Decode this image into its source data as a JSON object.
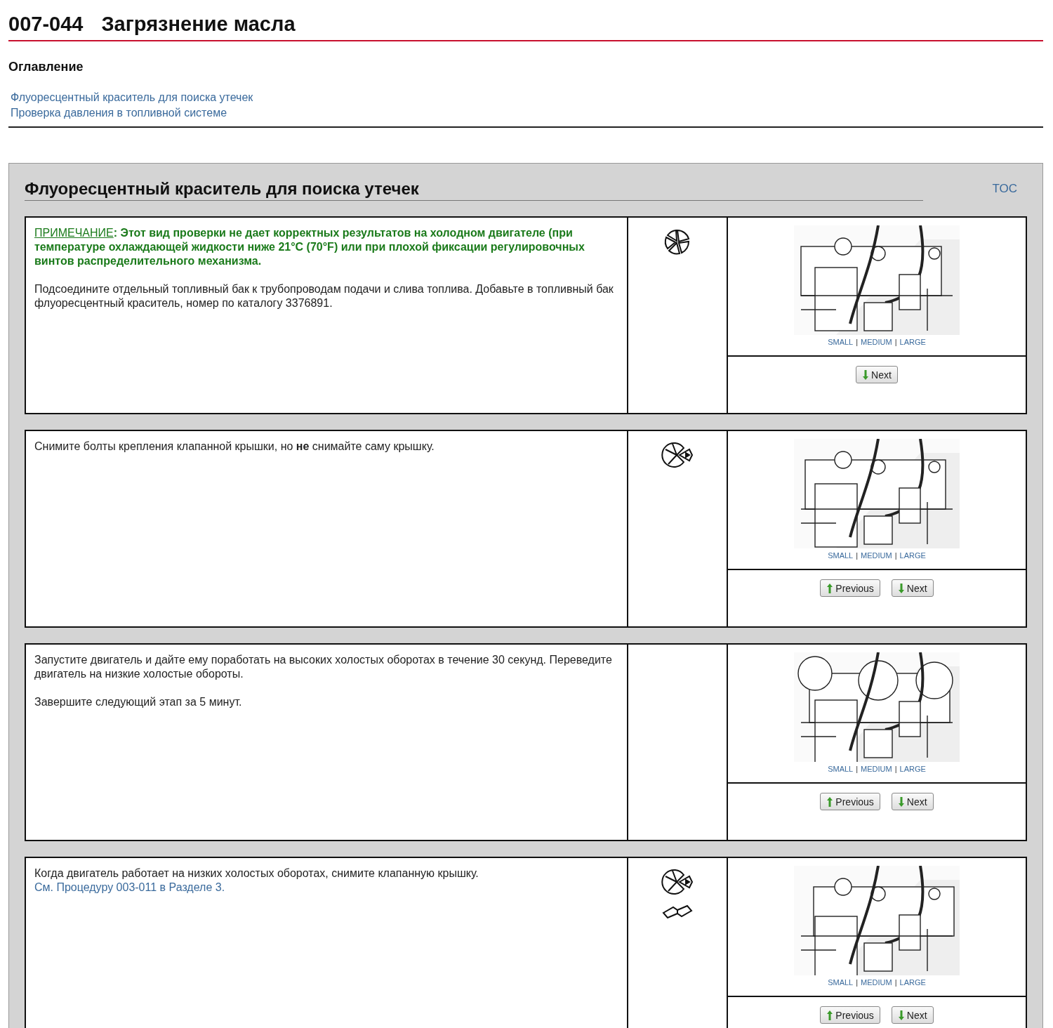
{
  "header": {
    "code": "007-044",
    "title": "Загрязнение масла"
  },
  "toc": {
    "title": "Оглавление",
    "links": [
      "Флуоресцентный краситель для поиска утечек",
      "Проверка давления в топливной системе"
    ]
  },
  "section": {
    "title": "Флуоресцентный краситель для поиска утечек",
    "toc_link": "TOC",
    "steps": [
      {
        "note": {
          "label": "ПРИМЕЧАНИЕ",
          "text": ": Этот вид проверки не дает корректных результатов на холодном двигателе (при температуре охлаждающей жидкости ниже 21°C (70°F) или при плохой фиксации регулировочных винтов распределительного механизма."
        },
        "paragraphs": [
          "Подсоедините отдельный топливный бак к трубопроводам подачи и слива топлива. Добавьте в топливный бак флуоресцентный краситель, номер по каталогу 3376891."
        ],
        "icons": [
          {
            "kind": "segmented"
          }
        ],
        "image": {
          "kind": "picture",
          "links": [
            "SMALL",
            "MEDIUM",
            "LARGE"
          ],
          "separator": "|"
        },
        "buttons": [
          {
            "kind": "next",
            "label": "Next"
          }
        ]
      },
      {
        "paragraphs": [
          "Снимите болты крепления клапанной крышки, но **не** снимайте саму крышку."
        ],
        "icons": [
          {
            "kind": "wedge"
          }
        ],
        "image": {
          "kind": "picture",
          "links": [
            "SMALL",
            "MEDIUM",
            "LARGE"
          ],
          "separator": "|"
        },
        "buttons": [
          {
            "kind": "previous",
            "label": "Previous"
          },
          {
            "kind": "next",
            "label": "Next"
          }
        ]
      },
      {
        "paragraphs": [
          "Запустите двигатель и дайте ему поработать на высоких холостых оборотах в течение 30 секунд. Переведите двигатель на низкие холостые обороты.",
          "Завершите следующий этап за 5 минут."
        ],
        "image": {
          "kind": "picture",
          "links": [
            "SMALL",
            "MEDIUM",
            "LARGE"
          ],
          "separator": "|"
        },
        "buttons": [
          {
            "kind": "previous",
            "label": "Previous"
          },
          {
            "kind": "next",
            "label": "Next"
          }
        ]
      },
      {
        "paragraphs": [
          "Когда двигатель работает на низких холостых оборотах, снимите клапанную крышку."
        ],
        "link": "См. Процедуру 003-011 в Разделе 3.",
        "icons": [
          {
            "kind": "wedge"
          },
          {
            "kind": "book"
          }
        ],
        "image": {
          "kind": "picture",
          "links": [
            "SMALL",
            "MEDIUM",
            "LARGE"
          ],
          "separator": "|"
        },
        "buttons": [
          {
            "kind": "previous",
            "label": "Previous"
          },
          {
            "kind": "next",
            "label": "Next"
          }
        ]
      }
    ]
  }
}
